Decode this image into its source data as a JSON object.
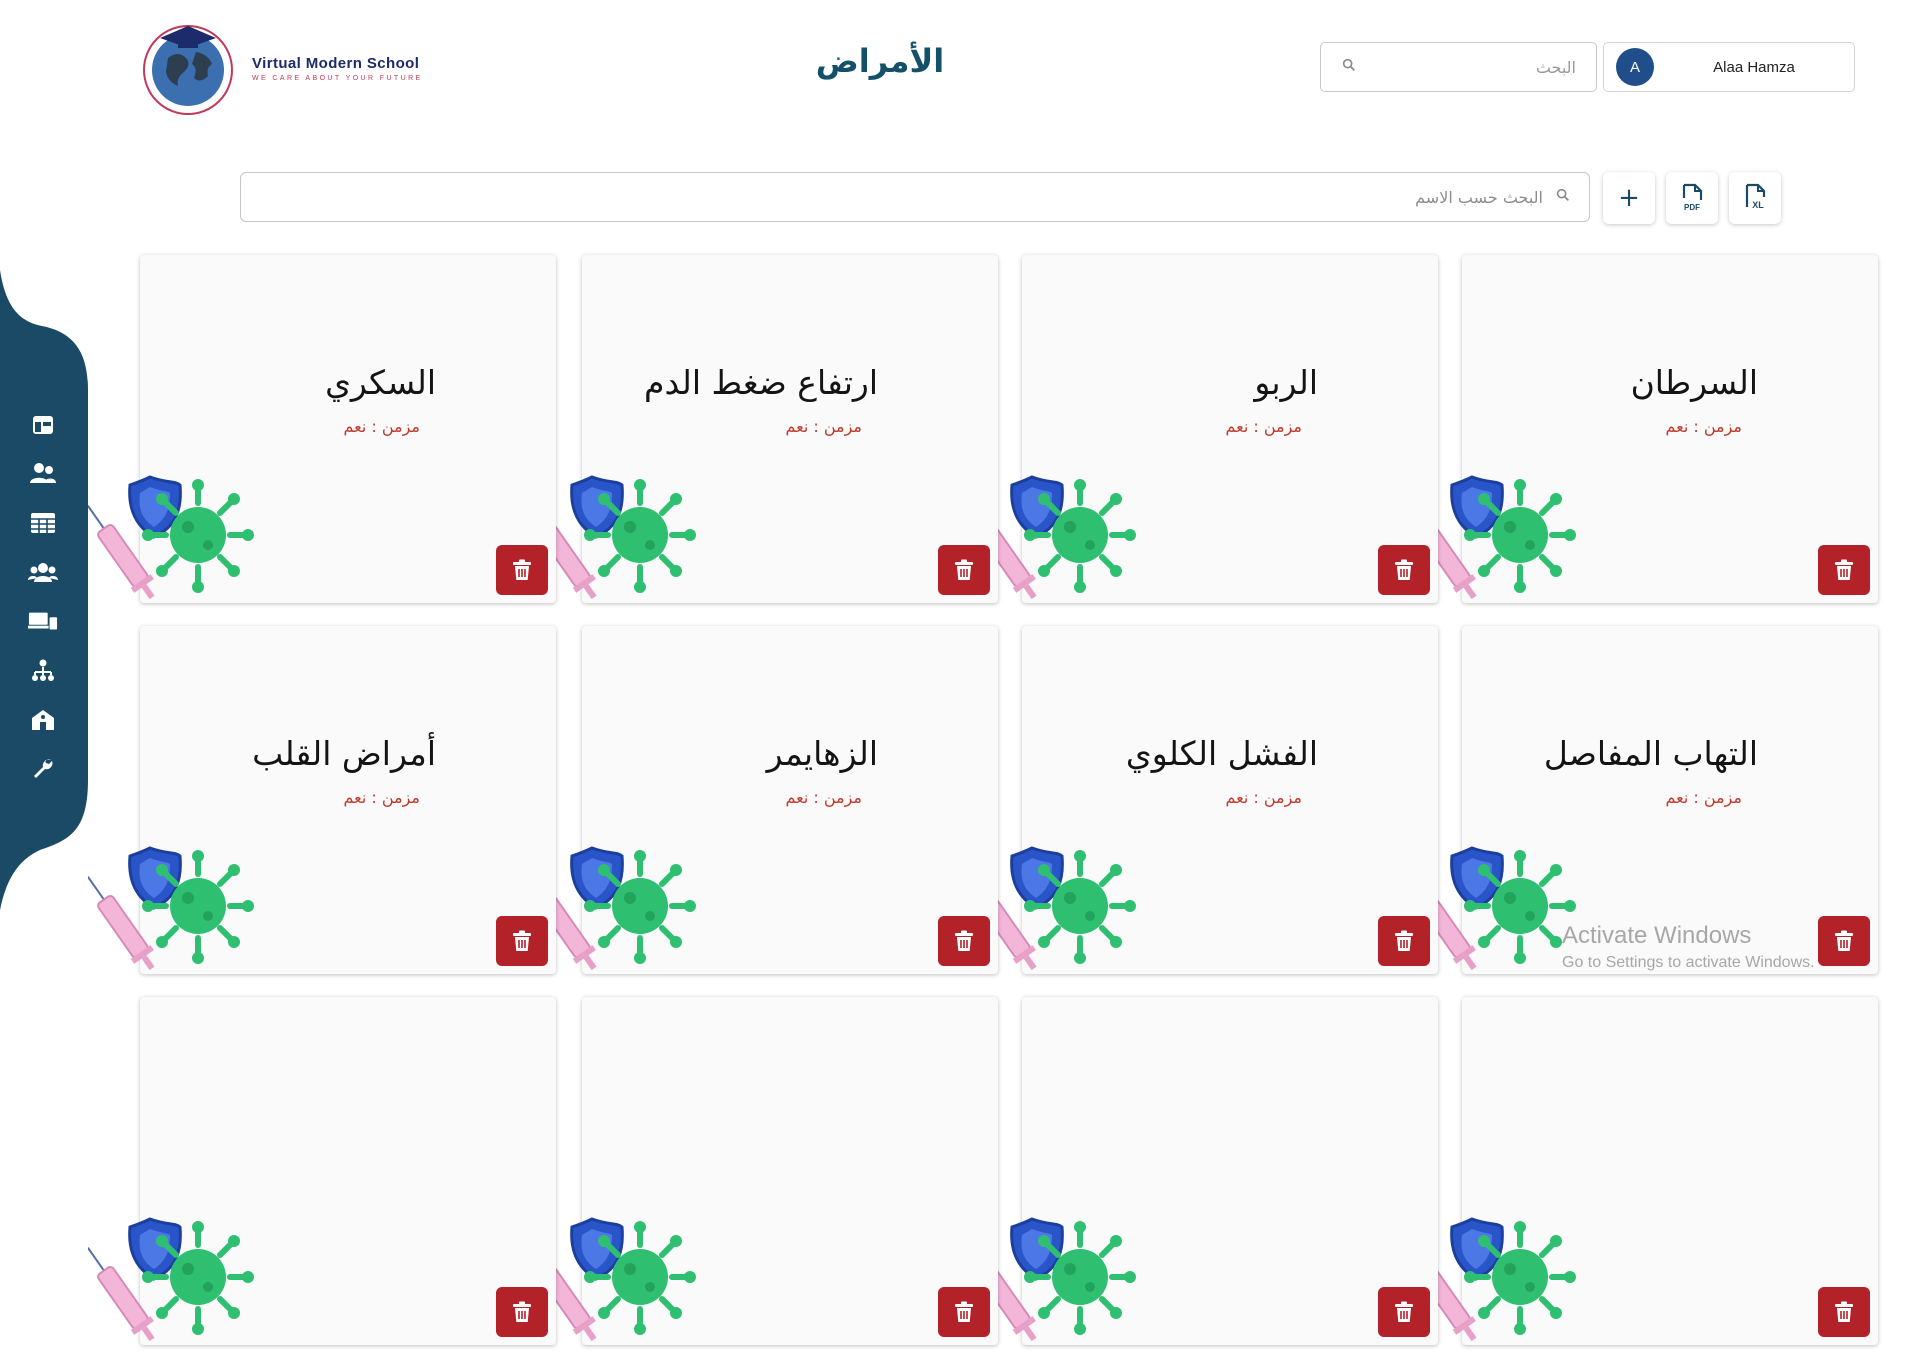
{
  "logo": {
    "title": "Virtual Modern School",
    "slogan": "WE CARE ABOUT YOUR FUTURE"
  },
  "header": {
    "page_title": "الأمراض"
  },
  "search": {
    "placeholder": "البحث"
  },
  "user": {
    "initial": "A",
    "name": "Alaa Hamza"
  },
  "toolbar": {
    "search_placeholder": "البحث حسب الاسم",
    "add_label": "+",
    "pdf_label": "PDF",
    "xl_label": "XL"
  },
  "sidebar": {
    "items": [
      {
        "icon": "dashboard-icon"
      },
      {
        "icon": "users-icon"
      },
      {
        "icon": "table-icon"
      },
      {
        "icon": "group-icon"
      },
      {
        "icon": "devices-icon"
      },
      {
        "icon": "hierarchy-icon"
      },
      {
        "icon": "school-icon"
      },
      {
        "icon": "wrench-icon"
      }
    ]
  },
  "cards": [
    {
      "name": "السرطان",
      "meta": "مزمن : نعم"
    },
    {
      "name": "الربو",
      "meta": "مزمن : نعم"
    },
    {
      "name": "ارتفاع ضغط الدم",
      "meta": "مزمن : نعم"
    },
    {
      "name": "السكري",
      "meta": "مزمن : نعم"
    },
    {
      "name": "التهاب المفاصل",
      "meta": "مزمن : نعم"
    },
    {
      "name": "الفشل الكلوي",
      "meta": "مزمن : نعم"
    },
    {
      "name": "الزهايمر",
      "meta": "مزمن : نعم"
    },
    {
      "name": "أمراض القلب",
      "meta": "مزمن : نعم"
    },
    {
      "name": "",
      "meta": ""
    },
    {
      "name": "",
      "meta": ""
    },
    {
      "name": "",
      "meta": ""
    },
    {
      "name": "",
      "meta": ""
    }
  ],
  "watermark": {
    "line1": "Activate Windows",
    "line2": "Go to Settings to activate Windows."
  },
  "colors": {
    "primary": "#15506a",
    "sidebar": "#1a4a66",
    "danger": "#b32129",
    "avatar": "#1f4e8a"
  }
}
